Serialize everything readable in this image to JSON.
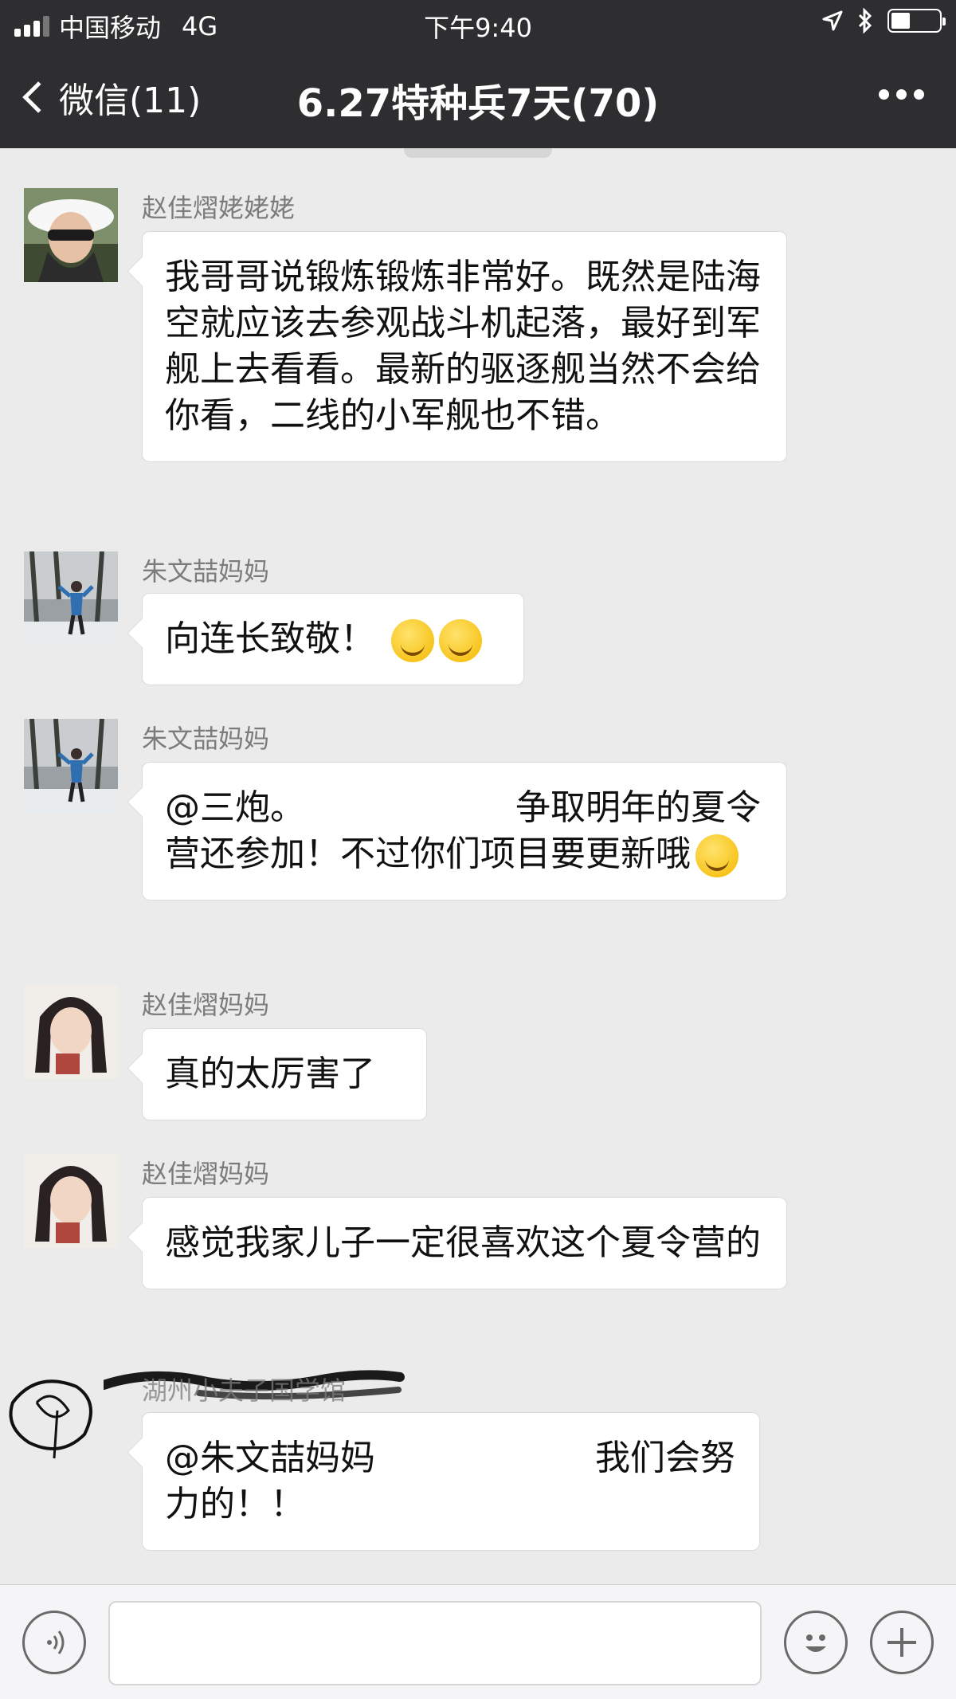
{
  "status_bar": {
    "carrier": "中国移动",
    "network": "4G",
    "time": "下午9:40"
  },
  "nav": {
    "back_label": "微信(11)",
    "title": "6.27特种兵7天(70)"
  },
  "messages": [
    {
      "sender": "赵佳熠姥姥姥",
      "text": "我哥哥说锻炼锻炼非常好。既然是陆海空就应该去参观战斗机起落，最好到军舰上去看看。最新的驱逐舰当然不会给你看，二线的小军舰也不错。"
    },
    {
      "sender": "朱文喆妈妈",
      "text": "向连长致敬！"
    },
    {
      "sender": "朱文喆妈妈",
      "text_a": "@三炮。",
      "text_b": "争取明年的夏令营还参加！不过你们项目要更新哦"
    },
    {
      "sender": "赵佳熠妈妈",
      "text": "真的太厉害了"
    },
    {
      "sender": "赵佳熠妈妈",
      "text": "感觉我家儿子一定很喜欢这个夏令营的"
    },
    {
      "sender": "湖州小夫子国学馆",
      "text_a": "@朱文喆妈妈",
      "text_b": "我们会努力的！！"
    }
  ],
  "colors": {
    "nav_bg": "#2e2e31",
    "chat_bg": "#ebebeb",
    "bubble_bg": "#ffffff"
  }
}
